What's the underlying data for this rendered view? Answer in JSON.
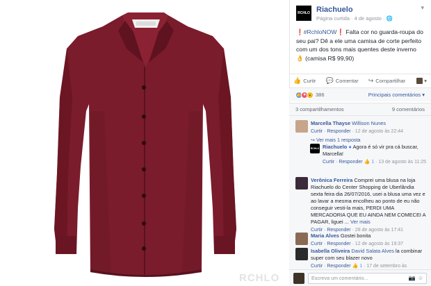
{
  "photo": {
    "watermark": "RCHLO",
    "shirt_color": "#7a1c2c"
  },
  "post": {
    "logo_text": "RCHLO",
    "page_name": "Riachuelo",
    "meta": "Página curtida · 4 de agosto · 🌐",
    "text_parts": {
      "hashtag": "#RchloNOW",
      "body": " Falta cor no guarda-roupa do seu pai? Dê a ele uma camisa de corte perfeito com um dos tons mais quentes deste inverno 👌 (camisa R$ 99,90)"
    },
    "accent_color": "#365899"
  },
  "actions": {
    "like": "Curtir",
    "comment": "Comentar",
    "share": "Compartilhar"
  },
  "reactions": {
    "count": "386",
    "top_comments": "Principais comentários ▾"
  },
  "shares": {
    "shares": "3 compartilhamentos",
    "comments": "9 comentários"
  },
  "comments": [
    {
      "name": "Marcella Thayse",
      "tag": "Willison Nunes",
      "text": "",
      "meta_reply": "Curtir · Responder",
      "meta_time": " · 12 de agosto às 22:44",
      "more_replies": "↪ Ver mais 1 resposta"
    },
    {
      "name": "Riachuelo",
      "text": " Agora é só vir pra cá buscar, Marcella!",
      "meta_reply": "Curtir · Responder",
      "meta_likes": "👍 1",
      "meta_time": " · 13 de agosto às 11:25"
    },
    {
      "name": "Verônica Ferreira",
      "text": " Comprei uma blusa na loja Riachuelo do Center Shopping de Uberlândia sexta feira dia 26/07/2016, usei a blusa uma vez e ao lavar a mesma encolheu ao ponto de eu não conseguir vesti-la mais, PERDI UMA MERCADORIA QUE EU AINDA NEM COMECEI A PAGAR, liguei ...",
      "see_more": "Ver mais",
      "meta_reply": "Curtir · Responder",
      "meta_time": " · 28 de agosto às 17:41"
    },
    {
      "name": "Maria Alves",
      "text": " Gostei bonita",
      "meta_reply": "Curtir · Responder",
      "meta_time": " · 12 de agosto às 19:37"
    },
    {
      "name": "Isabella Oliveira",
      "tag": "David Salata Alves",
      "text": " la combinar super com seu blazer novo",
      "meta_reply": "Curtir · Responder",
      "meta_likes": "👍 1",
      "meta_time": " · 17 de setembro às"
    }
  ],
  "composer": {
    "placeholder": "Escreva um comentário..."
  }
}
